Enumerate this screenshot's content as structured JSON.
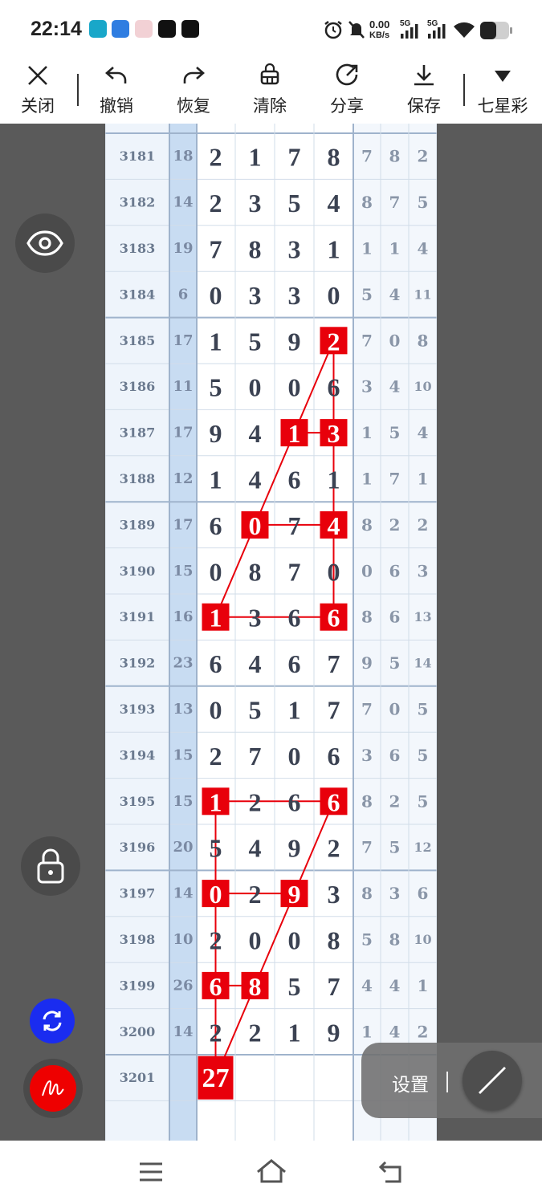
{
  "status_bar": {
    "time": "22:14",
    "net_speed_value": "0.00",
    "net_speed_unit": "KB/s",
    "signal1": "5G",
    "signal2": "5G"
  },
  "toolbar": {
    "close_label": "关闭",
    "undo_label": "撤销",
    "redo_label": "恢复",
    "clear_label": "清除",
    "share_label": "分享",
    "save_label": "保存",
    "lottery_label": "七星彩"
  },
  "table": {
    "rows": [
      {
        "issue": "3181",
        "sum": "18",
        "digits": [
          "2",
          "1",
          "7",
          "8"
        ],
        "extra": [
          "7",
          "8",
          "2"
        ]
      },
      {
        "issue": "3182",
        "sum": "14",
        "digits": [
          "2",
          "3",
          "5",
          "4"
        ],
        "extra": [
          "8",
          "7",
          "5"
        ]
      },
      {
        "issue": "3183",
        "sum": "19",
        "digits": [
          "7",
          "8",
          "3",
          "1"
        ],
        "extra": [
          "1",
          "1",
          "4"
        ]
      },
      {
        "issue": "3184",
        "sum": "6",
        "digits": [
          "0",
          "3",
          "3",
          "0"
        ],
        "extra": [
          "5",
          "4",
          "11"
        ]
      },
      {
        "issue": "3185",
        "sum": "17",
        "digits": [
          "1",
          "5",
          "9",
          "2"
        ],
        "extra": [
          "7",
          "0",
          "8"
        ]
      },
      {
        "issue": "3186",
        "sum": "11",
        "digits": [
          "5",
          "0",
          "0",
          "6"
        ],
        "extra": [
          "3",
          "4",
          "10"
        ]
      },
      {
        "issue": "3187",
        "sum": "17",
        "digits": [
          "9",
          "4",
          "1",
          "3"
        ],
        "extra": [
          "1",
          "5",
          "4"
        ]
      },
      {
        "issue": "3188",
        "sum": "12",
        "digits": [
          "1",
          "4",
          "6",
          "1"
        ],
        "extra": [
          "1",
          "7",
          "1"
        ]
      },
      {
        "issue": "3189",
        "sum": "17",
        "digits": [
          "6",
          "0",
          "7",
          "4"
        ],
        "extra": [
          "8",
          "2",
          "2"
        ]
      },
      {
        "issue": "3190",
        "sum": "15",
        "digits": [
          "0",
          "8",
          "7",
          "0"
        ],
        "extra": [
          "0",
          "6",
          "3"
        ]
      },
      {
        "issue": "3191",
        "sum": "16",
        "digits": [
          "1",
          "3",
          "6",
          "6"
        ],
        "extra": [
          "8",
          "6",
          "13"
        ]
      },
      {
        "issue": "3192",
        "sum": "23",
        "digits": [
          "6",
          "4",
          "6",
          "7"
        ],
        "extra": [
          "9",
          "5",
          "14"
        ]
      },
      {
        "issue": "3193",
        "sum": "13",
        "digits": [
          "0",
          "5",
          "1",
          "7"
        ],
        "extra": [
          "7",
          "0",
          "5"
        ]
      },
      {
        "issue": "3194",
        "sum": "15",
        "digits": [
          "2",
          "7",
          "0",
          "6"
        ],
        "extra": [
          "3",
          "6",
          "5"
        ]
      },
      {
        "issue": "3195",
        "sum": "15",
        "digits": [
          "1",
          "2",
          "6",
          "6"
        ],
        "extra": [
          "8",
          "2",
          "5"
        ]
      },
      {
        "issue": "3196",
        "sum": "20",
        "digits": [
          "5",
          "4",
          "9",
          "2"
        ],
        "extra": [
          "7",
          "5",
          "12"
        ]
      },
      {
        "issue": "3197",
        "sum": "14",
        "digits": [
          "0",
          "2",
          "9",
          "3"
        ],
        "extra": [
          "8",
          "3",
          "6"
        ]
      },
      {
        "issue": "3198",
        "sum": "10",
        "digits": [
          "2",
          "0",
          "0",
          "8"
        ],
        "extra": [
          "5",
          "8",
          "10"
        ]
      },
      {
        "issue": "3199",
        "sum": "26",
        "digits": [
          "6",
          "8",
          "5",
          "7"
        ],
        "extra": [
          "4",
          "4",
          "1"
        ]
      },
      {
        "issue": "3200",
        "sum": "14",
        "digits": [
          "2",
          "2",
          "1",
          "9"
        ],
        "extra": [
          "1",
          "4",
          "2"
        ]
      },
      {
        "issue": "3201",
        "sum": "",
        "digits": [
          "27",
          "",
          "",
          ""
        ],
        "extra": [
          "",
          "",
          ""
        ]
      }
    ],
    "highlights": [
      {
        "row": 4,
        "col": 3
      },
      {
        "row": 6,
        "col": 2
      },
      {
        "row": 6,
        "col": 3
      },
      {
        "row": 8,
        "col": 1
      },
      {
        "row": 8,
        "col": 3
      },
      {
        "row": 10,
        "col": 0
      },
      {
        "row": 10,
        "col": 3
      },
      {
        "row": 14,
        "col": 0
      },
      {
        "row": 14,
        "col": 3
      },
      {
        "row": 16,
        "col": 0
      },
      {
        "row": 16,
        "col": 2
      },
      {
        "row": 18,
        "col": 0
      },
      {
        "row": 18,
        "col": 1
      },
      {
        "row": 20,
        "col": 0
      }
    ],
    "lines": [
      [
        [
          4,
          3
        ],
        [
          5,
          3
        ],
        [
          6,
          3
        ],
        [
          7,
          3
        ],
        [
          8,
          3
        ],
        [
          9,
          3
        ],
        [
          10,
          3
        ]
      ],
      [
        [
          4,
          3
        ],
        [
          6,
          2
        ],
        [
          8,
          1
        ],
        [
          10,
          0
        ]
      ],
      [
        [
          6,
          2
        ],
        [
          6,
          3
        ]
      ],
      [
        [
          8,
          1
        ],
        [
          8,
          3
        ]
      ],
      [
        [
          10,
          0
        ],
        [
          10,
          3
        ]
      ],
      [
        [
          14,
          0
        ],
        [
          14,
          3
        ]
      ],
      [
        [
          14,
          0
        ],
        [
          16,
          0
        ],
        [
          18,
          0
        ],
        [
          20,
          0
        ]
      ],
      [
        [
          14,
          3
        ],
        [
          16,
          2
        ],
        [
          18,
          1
        ],
        [
          20,
          0
        ]
      ],
      [
        [
          16,
          0
        ],
        [
          16,
          2
        ]
      ],
      [
        [
          18,
          0
        ],
        [
          18,
          1
        ]
      ]
    ]
  },
  "settings": {
    "label": "设置"
  },
  "colors": {
    "highlight": "#e8000b",
    "sum_column": "#c8dcf2",
    "side_panel": "#5a5a5a",
    "digit_text": "#3b4252"
  }
}
